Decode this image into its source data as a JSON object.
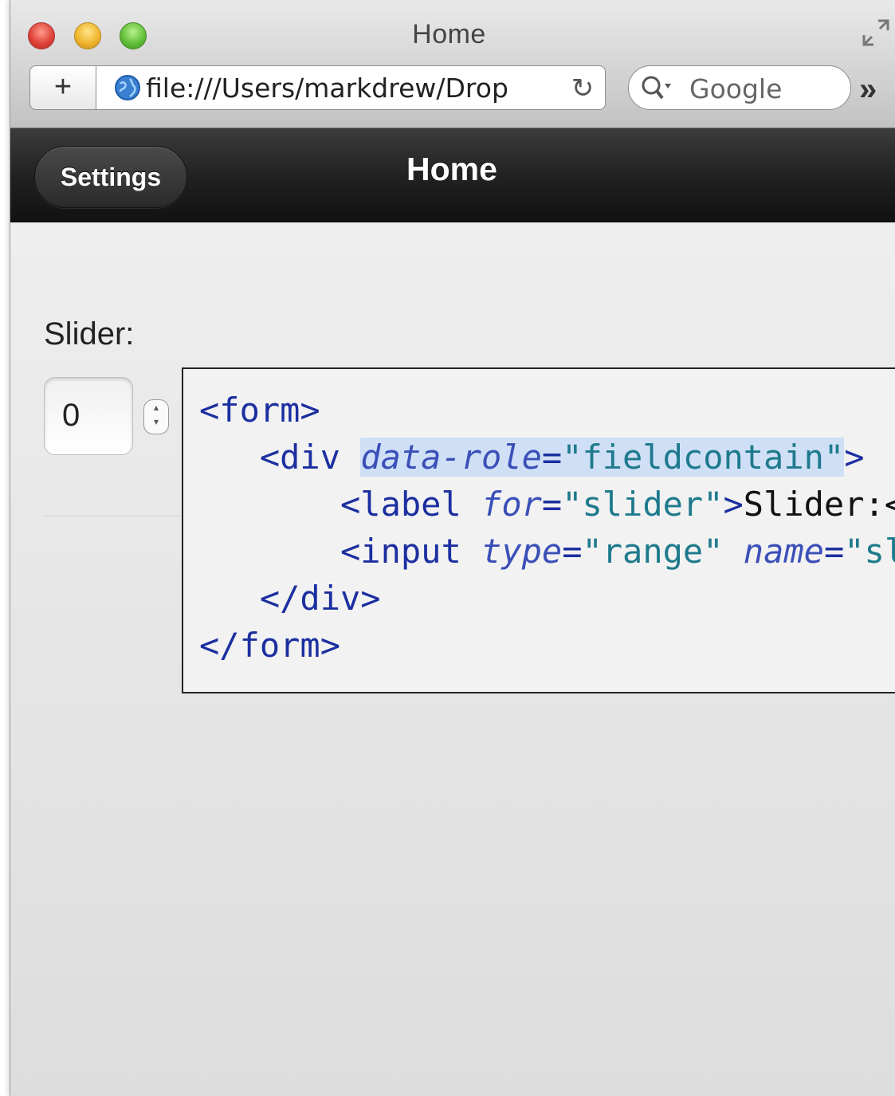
{
  "window": {
    "title": "Home",
    "url": "file:///Users/markdrew/Drop",
    "search_placeholder": "Google",
    "add_button": "+",
    "overflow": "»"
  },
  "app": {
    "settings_label": "Settings",
    "header_title": "Home"
  },
  "form": {
    "slider_label": "Slider:",
    "slider_value": "0"
  },
  "code_overlay": {
    "lines": [
      "<form>",
      "<div data-role=\"fieldcontain\">",
      "<label for=\"slider\">Slider:<",
      "<input type=\"range\" name=\"sl",
      "</div>",
      "</form>"
    ],
    "parts": {
      "form_open": "<form>",
      "div_open": "<div",
      "div_attr": "data-role",
      "div_eq": "=",
      "div_val": "\"fieldcontain\"",
      "div_close_bracket": ">",
      "label_open": "<label",
      "label_attr": "for",
      "label_eq": "=",
      "label_val": "\"slider\"",
      "label_close_bracket": ">",
      "label_text": "Slider:<",
      "input_open": "<input",
      "input_attr1": "type",
      "input_eq1": "=",
      "input_val1": "\"range\"",
      "input_attr2": "name",
      "input_eq2": "=",
      "input_val2": "\"sl",
      "div_end": "</div>",
      "form_end": "</form>"
    }
  },
  "colors": {
    "header_bg": "#1f1f1f",
    "content_bg": "#e6e6e6",
    "code_tag": "#1c2fa0",
    "code_value": "#1e7a8c",
    "selection": "#cfe0f6"
  }
}
